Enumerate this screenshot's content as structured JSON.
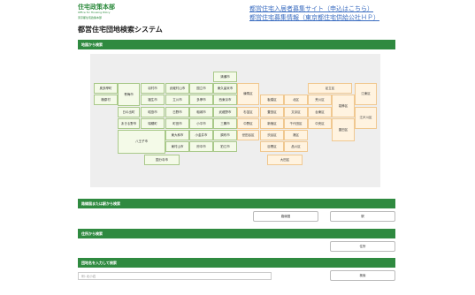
{
  "header": {
    "logo_title": "住宅政策本部",
    "logo_sub": "Office for Housing Policy",
    "logo_sub2": "東京都住宅政策本部",
    "links": [
      "都営住宅入居者募集サイト（申込はこちら）",
      "都営住宅募集情報（東京都住宅供給公社ＨＰ）"
    ],
    "page_title": "都営住宅団地検索システム"
  },
  "sections": {
    "map": "地図から検索",
    "line": "路線図または駅から検索",
    "address": "住所から検索",
    "name": "団地名を入力して検索"
  },
  "buttons": {
    "line_map": "路線図",
    "station": "駅",
    "address": "住所",
    "search": "検索"
  },
  "search": {
    "placeholder": "例: 北小岩"
  },
  "colors": {
    "accent": "#2f8a40",
    "city_cell": "#f4fae8",
    "ward_cell": "#fff3e0"
  },
  "map": {
    "areas": [
      "奥多摩町",
      "檜原村",
      "日の出町",
      "あきる野市",
      "八王子市",
      "青梅市",
      "羽村市",
      "福生市",
      "昭島市",
      "瑞穂町",
      "武蔵村山市",
      "立川市",
      "日野市",
      "町田市",
      "東大和市",
      "東村山市",
      "国分寺市",
      "国立市",
      "多摩市",
      "稲城市",
      "小平市",
      "小金井市",
      "府中市",
      "清瀬市",
      "東久留米市",
      "西東京市",
      "武蔵野市",
      "三鷹市",
      "調布市",
      "狛江市",
      "練馬区",
      "杉並区",
      "中野区",
      "世田谷区",
      "板橋区",
      "豊島区",
      "新宿区",
      "渋谷区",
      "目黒区",
      "北区",
      "文京区",
      "千代田区",
      "港区",
      "品川区",
      "大田区",
      "足立区",
      "荒川区",
      "台東区",
      "中央区",
      "葛飾区",
      "墨田区",
      "江東区",
      "江戸川区"
    ]
  }
}
